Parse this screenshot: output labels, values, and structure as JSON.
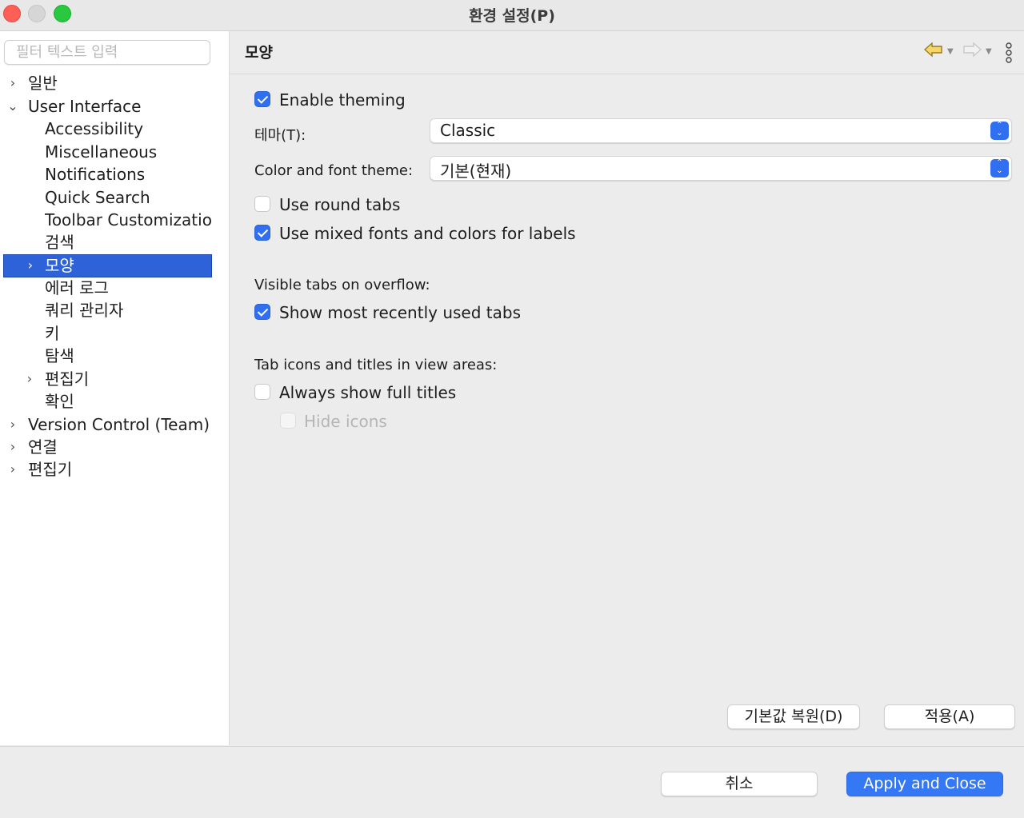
{
  "window": {
    "title": "환경 설정(P)"
  },
  "sidebar": {
    "filter_placeholder": "필터 텍스트 입력",
    "items": [
      {
        "label": "일반",
        "expander": ">"
      },
      {
        "label": "User Interface",
        "expander": "v"
      },
      {
        "label": "Accessibility"
      },
      {
        "label": "Miscellaneous"
      },
      {
        "label": "Notifications"
      },
      {
        "label": "Quick Search"
      },
      {
        "label": "Toolbar Customization"
      },
      {
        "label": "검색"
      },
      {
        "label": "모양",
        "expander": ">",
        "selected": true
      },
      {
        "label": "에러 로그"
      },
      {
        "label": "쿼리 관리자"
      },
      {
        "label": "키"
      },
      {
        "label": "탐색"
      },
      {
        "label": "편집기",
        "expander": ">"
      },
      {
        "label": "확인"
      },
      {
        "label": "Version Control (Team)",
        "expander": ">"
      },
      {
        "label": "연결",
        "expander": ">"
      },
      {
        "label": "편집기",
        "expander": ">"
      }
    ]
  },
  "page": {
    "title": "모양",
    "enable_theming": {
      "label": "Enable theming",
      "checked": true
    },
    "theme": {
      "label": "테마(T):",
      "value": "Classic"
    },
    "color_font_theme": {
      "label": "Color and font theme:",
      "value": "기본(현재)"
    },
    "round_tabs": {
      "label": "Use round tabs",
      "checked": false
    },
    "mixed_fonts": {
      "label": "Use mixed fonts and colors for labels",
      "checked": true
    },
    "overflow_heading": "Visible tabs on overflow:",
    "mru_tabs": {
      "label": "Show most recently used tabs",
      "checked": true
    },
    "tab_icons_heading": "Tab icons and titles in view areas:",
    "full_titles": {
      "label": "Always show full titles",
      "checked": false
    },
    "hide_icons": {
      "label": "Hide icons",
      "checked": false,
      "enabled": false
    },
    "restore_defaults_label": "기본값 복원(D)",
    "apply_label": "적용(A)"
  },
  "footer": {
    "cancel_label": "취소",
    "apply_close_label": "Apply and Close"
  },
  "colors": {
    "accent": "#3478f6",
    "selection": "#2d62d9"
  }
}
